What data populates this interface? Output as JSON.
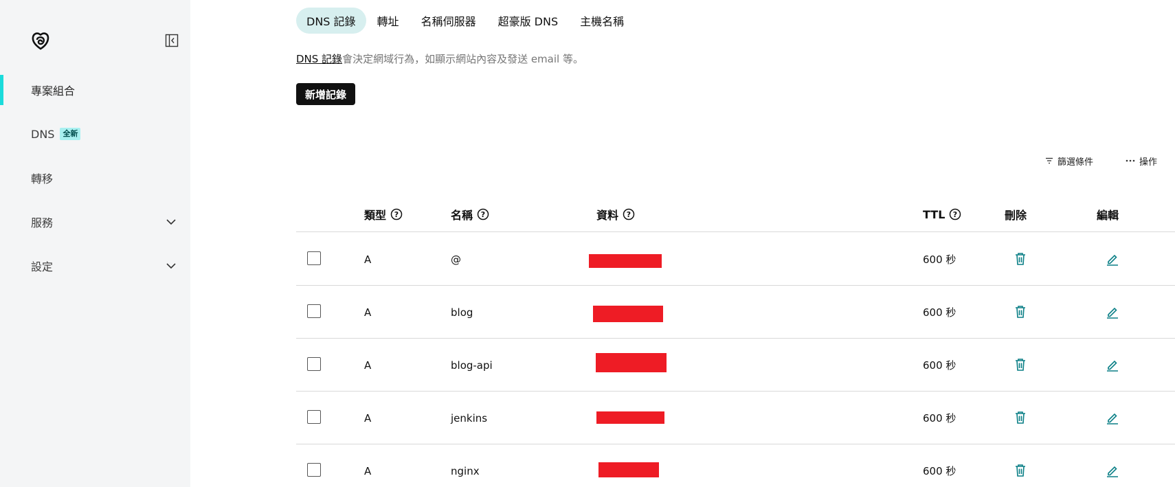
{
  "sidebar": {
    "collapse_icon": "sidebar-collapse-icon",
    "items": [
      {
        "label": "專案組合",
        "active": true
      },
      {
        "label": "DNS",
        "badge": "全新"
      },
      {
        "label": "轉移"
      },
      {
        "label": "服務",
        "expandable": true
      },
      {
        "label": "設定",
        "expandable": true
      }
    ]
  },
  "tabs": [
    "DNS 記錄",
    "轉址",
    "名稱伺服器",
    "超豪版 DNS",
    "主機名稱"
  ],
  "description": {
    "link": "DNS 記錄",
    "text": "會決定網域行為，如顯示網站內容及發送 email 等。"
  },
  "add_button": "新增記錄",
  "tools": {
    "filter": "篩選條件",
    "actions": "操作"
  },
  "table": {
    "headers": {
      "type": "類型",
      "name": "名稱",
      "data": "資料",
      "ttl": "TTL",
      "delete": "刪除",
      "edit": "編輯"
    },
    "rows": [
      {
        "type": "A",
        "name": "@",
        "ttl": "600 秒"
      },
      {
        "type": "A",
        "name": "blog",
        "ttl": "600 秒"
      },
      {
        "type": "A",
        "name": "blog-api",
        "ttl": "600 秒"
      },
      {
        "type": "A",
        "name": "jenkins",
        "ttl": "600 秒"
      },
      {
        "type": "A",
        "name": "nginx",
        "ttl": "600 秒"
      }
    ]
  },
  "colors": {
    "accent": "#1bdbdb",
    "icon_teal": "#0a7f86",
    "redaction": "#ee1c25"
  }
}
